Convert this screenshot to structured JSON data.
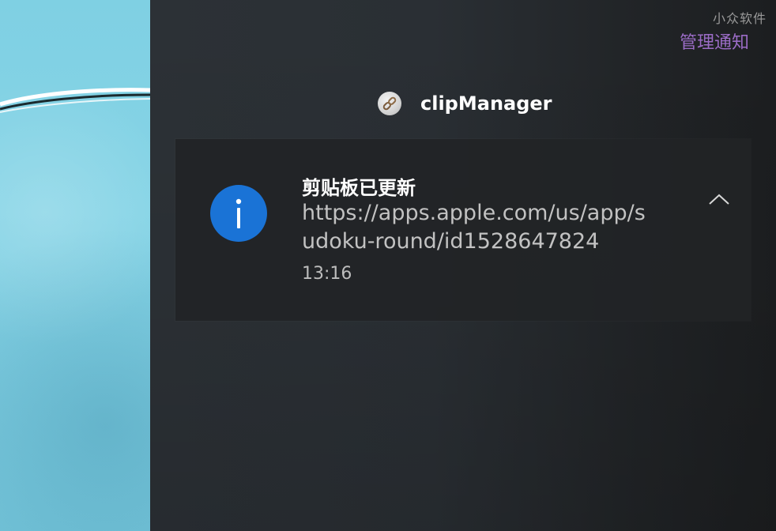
{
  "watermark": "小众软件",
  "header": {
    "manage_label": "管理通知"
  },
  "app": {
    "name": "clipManager",
    "icon": "link-icon"
  },
  "notification": {
    "icon": "info-icon",
    "title": "剪贴板已更新",
    "body": "https://apps.apple.com/us/app/sudoku-round/id1528647824",
    "time": "13:16",
    "collapse_icon": "chevron-up-icon"
  },
  "colors": {
    "accent_link": "#9b6cc6",
    "info_blue": "#1a73d6",
    "panel_bg": "#2a2f34"
  }
}
